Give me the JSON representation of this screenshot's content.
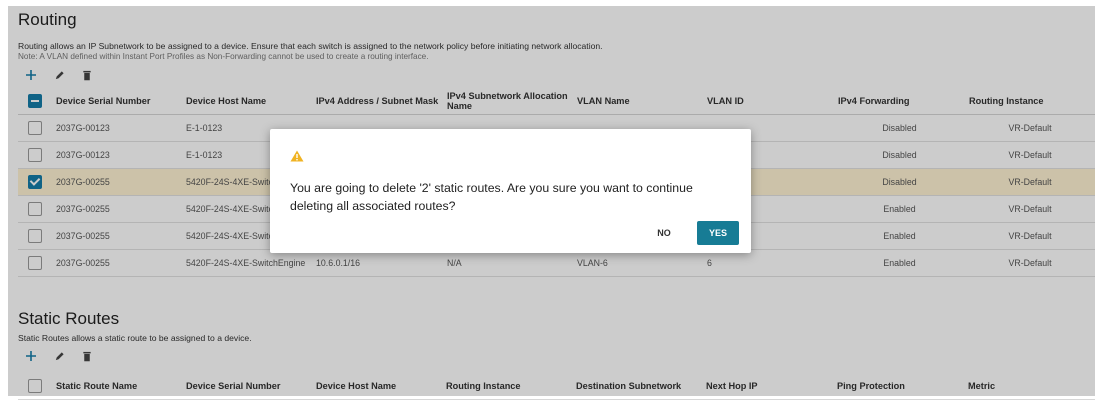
{
  "routing": {
    "title": "Routing",
    "description": "Routing allows an IP Subnetwork to be assigned to a device. Ensure that each switch is assigned to the network policy before initiating network allocation.",
    "note": "Note: A VLAN defined within Instant Port Profiles as Non-Forwarding cannot be used to create a routing interface.",
    "columns": [
      "Device Serial Number",
      "Device Host Name",
      "IPv4 Address / Subnet Mask",
      "IPv4 Subnetwork Allocation Name",
      "VLAN Name",
      "VLAN ID",
      "IPv4 Forwarding",
      "Routing Instance"
    ],
    "rows": [
      {
        "serial": "2037G-00123",
        "host": "E-1-0123",
        "ipv4": "",
        "alloc": "",
        "vlan_name": "",
        "vlan_id": "",
        "forwarding": "Disabled",
        "instance": "VR-Default",
        "selected": false
      },
      {
        "serial": "2037G-00123",
        "host": "E-1-0123",
        "ipv4": "",
        "alloc": "",
        "vlan_name": "",
        "vlan_id": "",
        "forwarding": "Disabled",
        "instance": "VR-Default",
        "selected": false
      },
      {
        "serial": "2037G-00255",
        "host": "5420F-24S-4XE-SwitchEngine",
        "ipv4": "",
        "alloc": "",
        "vlan_name": "",
        "vlan_id": "",
        "forwarding": "Disabled",
        "instance": "VR-Default",
        "selected": true
      },
      {
        "serial": "2037G-00255",
        "host": "5420F-24S-4XE-SwitchEngine",
        "ipv4": "",
        "alloc": "",
        "vlan_name": "",
        "vlan_id": "",
        "forwarding": "Enabled",
        "instance": "VR-Default",
        "selected": false
      },
      {
        "serial": "2037G-00255",
        "host": "5420F-24S-4XE-SwitchEngine",
        "ipv4": "",
        "alloc": "",
        "vlan_name": "",
        "vlan_id": "",
        "forwarding": "Enabled",
        "instance": "VR-Default",
        "selected": false
      },
      {
        "serial": "2037G-00255",
        "host": "5420F-24S-4XE-SwitchEngine",
        "ipv4": "10.6.0.1/16",
        "alloc": "N/A",
        "vlan_name": "VLAN-6",
        "vlan_id": "6",
        "forwarding": "Enabled",
        "instance": "VR-Default",
        "selected": false
      }
    ]
  },
  "static_routes": {
    "title": "Static Routes",
    "description": "Static Routes allows a static route to be assigned to a device.",
    "columns": [
      "Static Route Name",
      "Device Serial Number",
      "Device Host Name",
      "Routing Instance",
      "Destination Subnetwork",
      "Next Hop IP",
      "Ping Protection",
      "Metric"
    ]
  },
  "dialog": {
    "message": "You are going to delete '2' static routes. Are you sure you want to continue deleting all associated routes?",
    "no_label": "NO",
    "yes_label": "YES"
  },
  "icons": {
    "add": "plus-icon",
    "edit": "pencil-icon",
    "delete": "trash-icon",
    "warning": "warning-icon"
  },
  "colors": {
    "accent": "#157ca8",
    "yes_button": "#177c95",
    "selected_row": "#fff3d4",
    "warning": "#f0b323"
  }
}
